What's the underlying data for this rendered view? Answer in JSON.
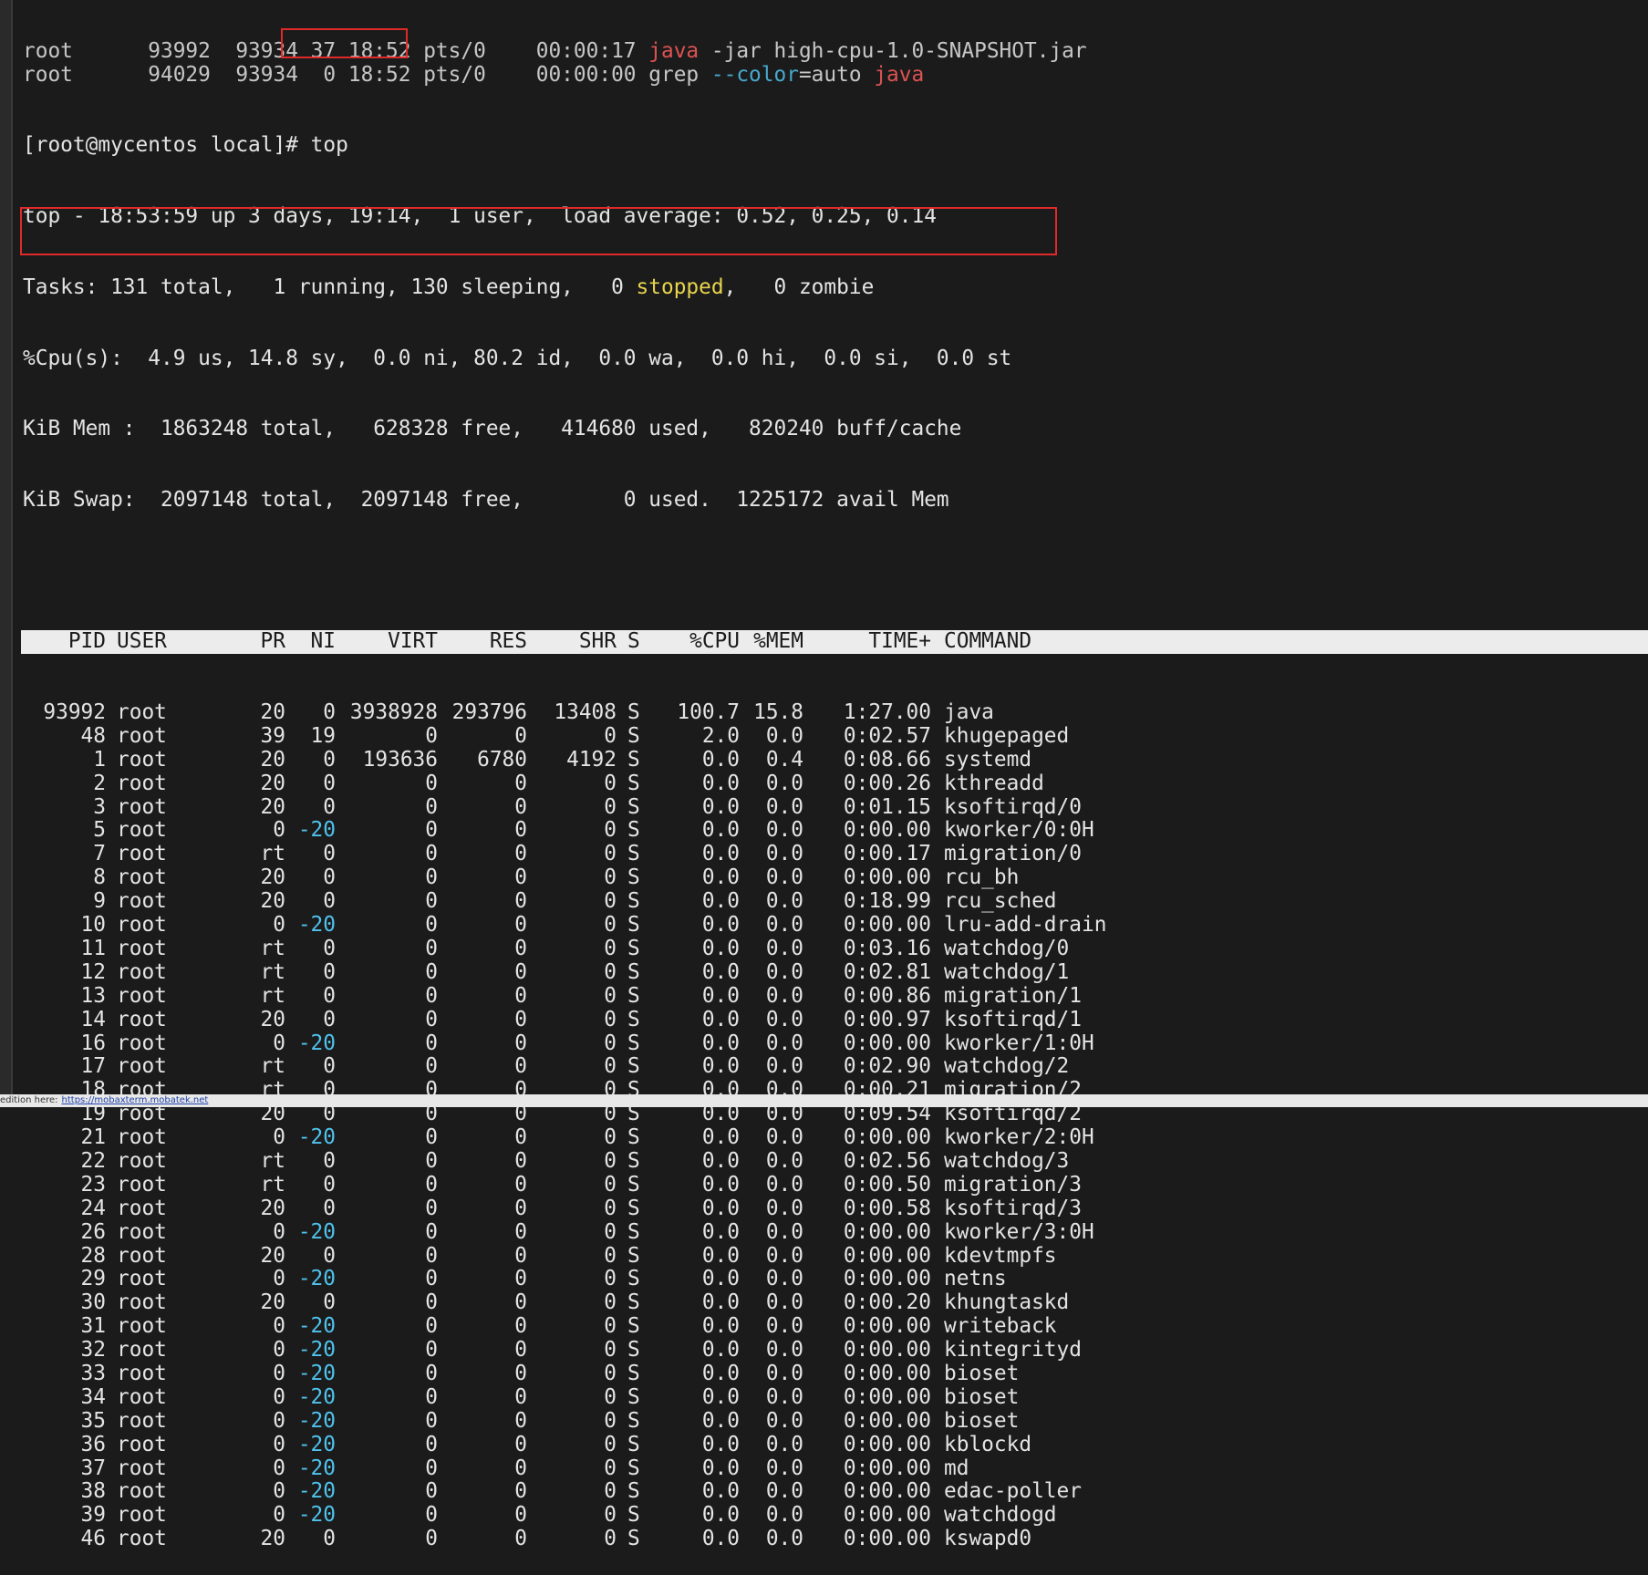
{
  "terminal": {
    "prev_lines": [
      {
        "segments": [
          {
            "t": "root      93992  93934 37 18:52 pts/0    00:00:17 ",
            "c": ""
          },
          {
            "t": "java",
            "c": "red"
          },
          {
            "t": " -jar high-cpu-1.0-SNAPSHOT.jar",
            "c": ""
          }
        ]
      },
      {
        "segments": [
          {
            "t": "root      94029  93934  0 18:52 pts/0    00:00:00 grep ",
            "c": ""
          },
          {
            "t": "--color",
            "c": "cyan"
          },
          {
            "t": "=auto ",
            "c": ""
          },
          {
            "t": "java",
            "c": "red"
          }
        ]
      }
    ],
    "prompt": "[root@mycentos local]",
    "command": "# top",
    "summary": [
      "top - 18:53:59 up 3 days, 19:14,  1 user,  load average: 0.52, 0.25, 0.14",
      {
        "before": "Tasks: 131 total,   1 running, 130 sleeping,   0 ",
        "highlight": "stopped",
        "after": ",   0 zombie"
      },
      "%Cpu(s):  4.9 us, 14.8 sy,  0.0 ni, 80.2 id,  0.0 wa,  0.0 hi,  0.0 si,  0.0 st",
      "KiB Mem :  1863248 total,   628328 free,   414680 used,   820240 buff/cache",
      "KiB Swap:  2097148 total,  2097148 free,        0 used.  1225172 avail Mem"
    ],
    "columns": [
      "PID",
      "USER",
      "PR",
      "NI",
      "VIRT",
      "RES",
      "SHR",
      "S",
      "%CPU",
      "%MEM",
      "TIME+",
      "COMMAND"
    ],
    "processes": [
      [
        "93992",
        "root",
        "20",
        "0",
        "3938928",
        "293796",
        "13408",
        "S",
        "100.7",
        "15.8",
        "1:27.00",
        "java"
      ],
      [
        "48",
        "root",
        "39",
        "19",
        "0",
        "0",
        "0",
        "S",
        "2.0",
        "0.0",
        "0:02.57",
        "khugepaged"
      ],
      [
        "1",
        "root",
        "20",
        "0",
        "193636",
        "6780",
        "4192",
        "S",
        "0.0",
        "0.4",
        "0:08.66",
        "systemd"
      ],
      [
        "2",
        "root",
        "20",
        "0",
        "0",
        "0",
        "0",
        "S",
        "0.0",
        "0.0",
        "0:00.26",
        "kthreadd"
      ],
      [
        "3",
        "root",
        "20",
        "0",
        "0",
        "0",
        "0",
        "S",
        "0.0",
        "0.0",
        "0:01.15",
        "ksoftirqd/0"
      ],
      [
        "5",
        "root",
        "0",
        "-20",
        "0",
        "0",
        "0",
        "S",
        "0.0",
        "0.0",
        "0:00.00",
        "kworker/0:0H"
      ],
      [
        "7",
        "root",
        "rt",
        "0",
        "0",
        "0",
        "0",
        "S",
        "0.0",
        "0.0",
        "0:00.17",
        "migration/0"
      ],
      [
        "8",
        "root",
        "20",
        "0",
        "0",
        "0",
        "0",
        "S",
        "0.0",
        "0.0",
        "0:00.00",
        "rcu_bh"
      ],
      [
        "9",
        "root",
        "20",
        "0",
        "0",
        "0",
        "0",
        "S",
        "0.0",
        "0.0",
        "0:18.99",
        "rcu_sched"
      ],
      [
        "10",
        "root",
        "0",
        "-20",
        "0",
        "0",
        "0",
        "S",
        "0.0",
        "0.0",
        "0:00.00",
        "lru-add-drain"
      ],
      [
        "11",
        "root",
        "rt",
        "0",
        "0",
        "0",
        "0",
        "S",
        "0.0",
        "0.0",
        "0:03.16",
        "watchdog/0"
      ],
      [
        "12",
        "root",
        "rt",
        "0",
        "0",
        "0",
        "0",
        "S",
        "0.0",
        "0.0",
        "0:02.81",
        "watchdog/1"
      ],
      [
        "13",
        "root",
        "rt",
        "0",
        "0",
        "0",
        "0",
        "S",
        "0.0",
        "0.0",
        "0:00.86",
        "migration/1"
      ],
      [
        "14",
        "root",
        "20",
        "0",
        "0",
        "0",
        "0",
        "S",
        "0.0",
        "0.0",
        "0:00.97",
        "ksoftirqd/1"
      ],
      [
        "16",
        "root",
        "0",
        "-20",
        "0",
        "0",
        "0",
        "S",
        "0.0",
        "0.0",
        "0:00.00",
        "kworker/1:0H"
      ],
      [
        "17",
        "root",
        "rt",
        "0",
        "0",
        "0",
        "0",
        "S",
        "0.0",
        "0.0",
        "0:02.90",
        "watchdog/2"
      ],
      [
        "18",
        "root",
        "rt",
        "0",
        "0",
        "0",
        "0",
        "S",
        "0.0",
        "0.0",
        "0:00.21",
        "migration/2"
      ],
      [
        "19",
        "root",
        "20",
        "0",
        "0",
        "0",
        "0",
        "S",
        "0.0",
        "0.0",
        "0:09.54",
        "ksoftirqd/2"
      ],
      [
        "21",
        "root",
        "0",
        "-20",
        "0",
        "0",
        "0",
        "S",
        "0.0",
        "0.0",
        "0:00.00",
        "kworker/2:0H"
      ],
      [
        "22",
        "root",
        "rt",
        "0",
        "0",
        "0",
        "0",
        "S",
        "0.0",
        "0.0",
        "0:02.56",
        "watchdog/3"
      ],
      [
        "23",
        "root",
        "rt",
        "0",
        "0",
        "0",
        "0",
        "S",
        "0.0",
        "0.0",
        "0:00.50",
        "migration/3"
      ],
      [
        "24",
        "root",
        "20",
        "0",
        "0",
        "0",
        "0",
        "S",
        "0.0",
        "0.0",
        "0:00.58",
        "ksoftirqd/3"
      ],
      [
        "26",
        "root",
        "0",
        "-20",
        "0",
        "0",
        "0",
        "S",
        "0.0",
        "0.0",
        "0:00.00",
        "kworker/3:0H"
      ],
      [
        "28",
        "root",
        "20",
        "0",
        "0",
        "0",
        "0",
        "S",
        "0.0",
        "0.0",
        "0:00.00",
        "kdevtmpfs"
      ],
      [
        "29",
        "root",
        "0",
        "-20",
        "0",
        "0",
        "0",
        "S",
        "0.0",
        "0.0",
        "0:00.00",
        "netns"
      ],
      [
        "30",
        "root",
        "20",
        "0",
        "0",
        "0",
        "0",
        "S",
        "0.0",
        "0.0",
        "0:00.20",
        "khungtaskd"
      ],
      [
        "31",
        "root",
        "0",
        "-20",
        "0",
        "0",
        "0",
        "S",
        "0.0",
        "0.0",
        "0:00.00",
        "writeback"
      ],
      [
        "32",
        "root",
        "0",
        "-20",
        "0",
        "0",
        "0",
        "S",
        "0.0",
        "0.0",
        "0:00.00",
        "kintegrityd"
      ],
      [
        "33",
        "root",
        "0",
        "-20",
        "0",
        "0",
        "0",
        "S",
        "0.0",
        "0.0",
        "0:00.00",
        "bioset"
      ],
      [
        "34",
        "root",
        "0",
        "-20",
        "0",
        "0",
        "0",
        "S",
        "0.0",
        "0.0",
        "0:00.00",
        "bioset"
      ],
      [
        "35",
        "root",
        "0",
        "-20",
        "0",
        "0",
        "0",
        "S",
        "0.0",
        "0.0",
        "0:00.00",
        "bioset"
      ],
      [
        "36",
        "root",
        "0",
        "-20",
        "0",
        "0",
        "0",
        "S",
        "0.0",
        "0.0",
        "0:00.00",
        "kblockd"
      ],
      [
        "37",
        "root",
        "0",
        "-20",
        "0",
        "0",
        "0",
        "S",
        "0.0",
        "0.0",
        "0:00.00",
        "md"
      ],
      [
        "38",
        "root",
        "0",
        "-20",
        "0",
        "0",
        "0",
        "S",
        "0.0",
        "0.0",
        "0:00.00",
        "edac-poller"
      ],
      [
        "39",
        "root",
        "0",
        "-20",
        "0",
        "0",
        "0",
        "S",
        "0.0",
        "0.0",
        "0:00.00",
        "watchdogd"
      ],
      [
        "46",
        "root",
        "20",
        "0",
        "0",
        "0",
        "0",
        "S",
        "0.0",
        "0.0",
        "0:00.00",
        "kswapd0"
      ]
    ]
  },
  "status_bar": {
    "text": "edition here:",
    "link": "https://mobaxterm.mobatek.net"
  },
  "colors": {
    "background": "#1b1b1b",
    "text": "#e4e4e4",
    "highlight_red": "#ff5c5c",
    "highlight_cyan": "#4fc3ee",
    "highlight_yellow": "#e8d44d",
    "annotation_box": "#e02a2a",
    "header_bg": "#ececec"
  }
}
